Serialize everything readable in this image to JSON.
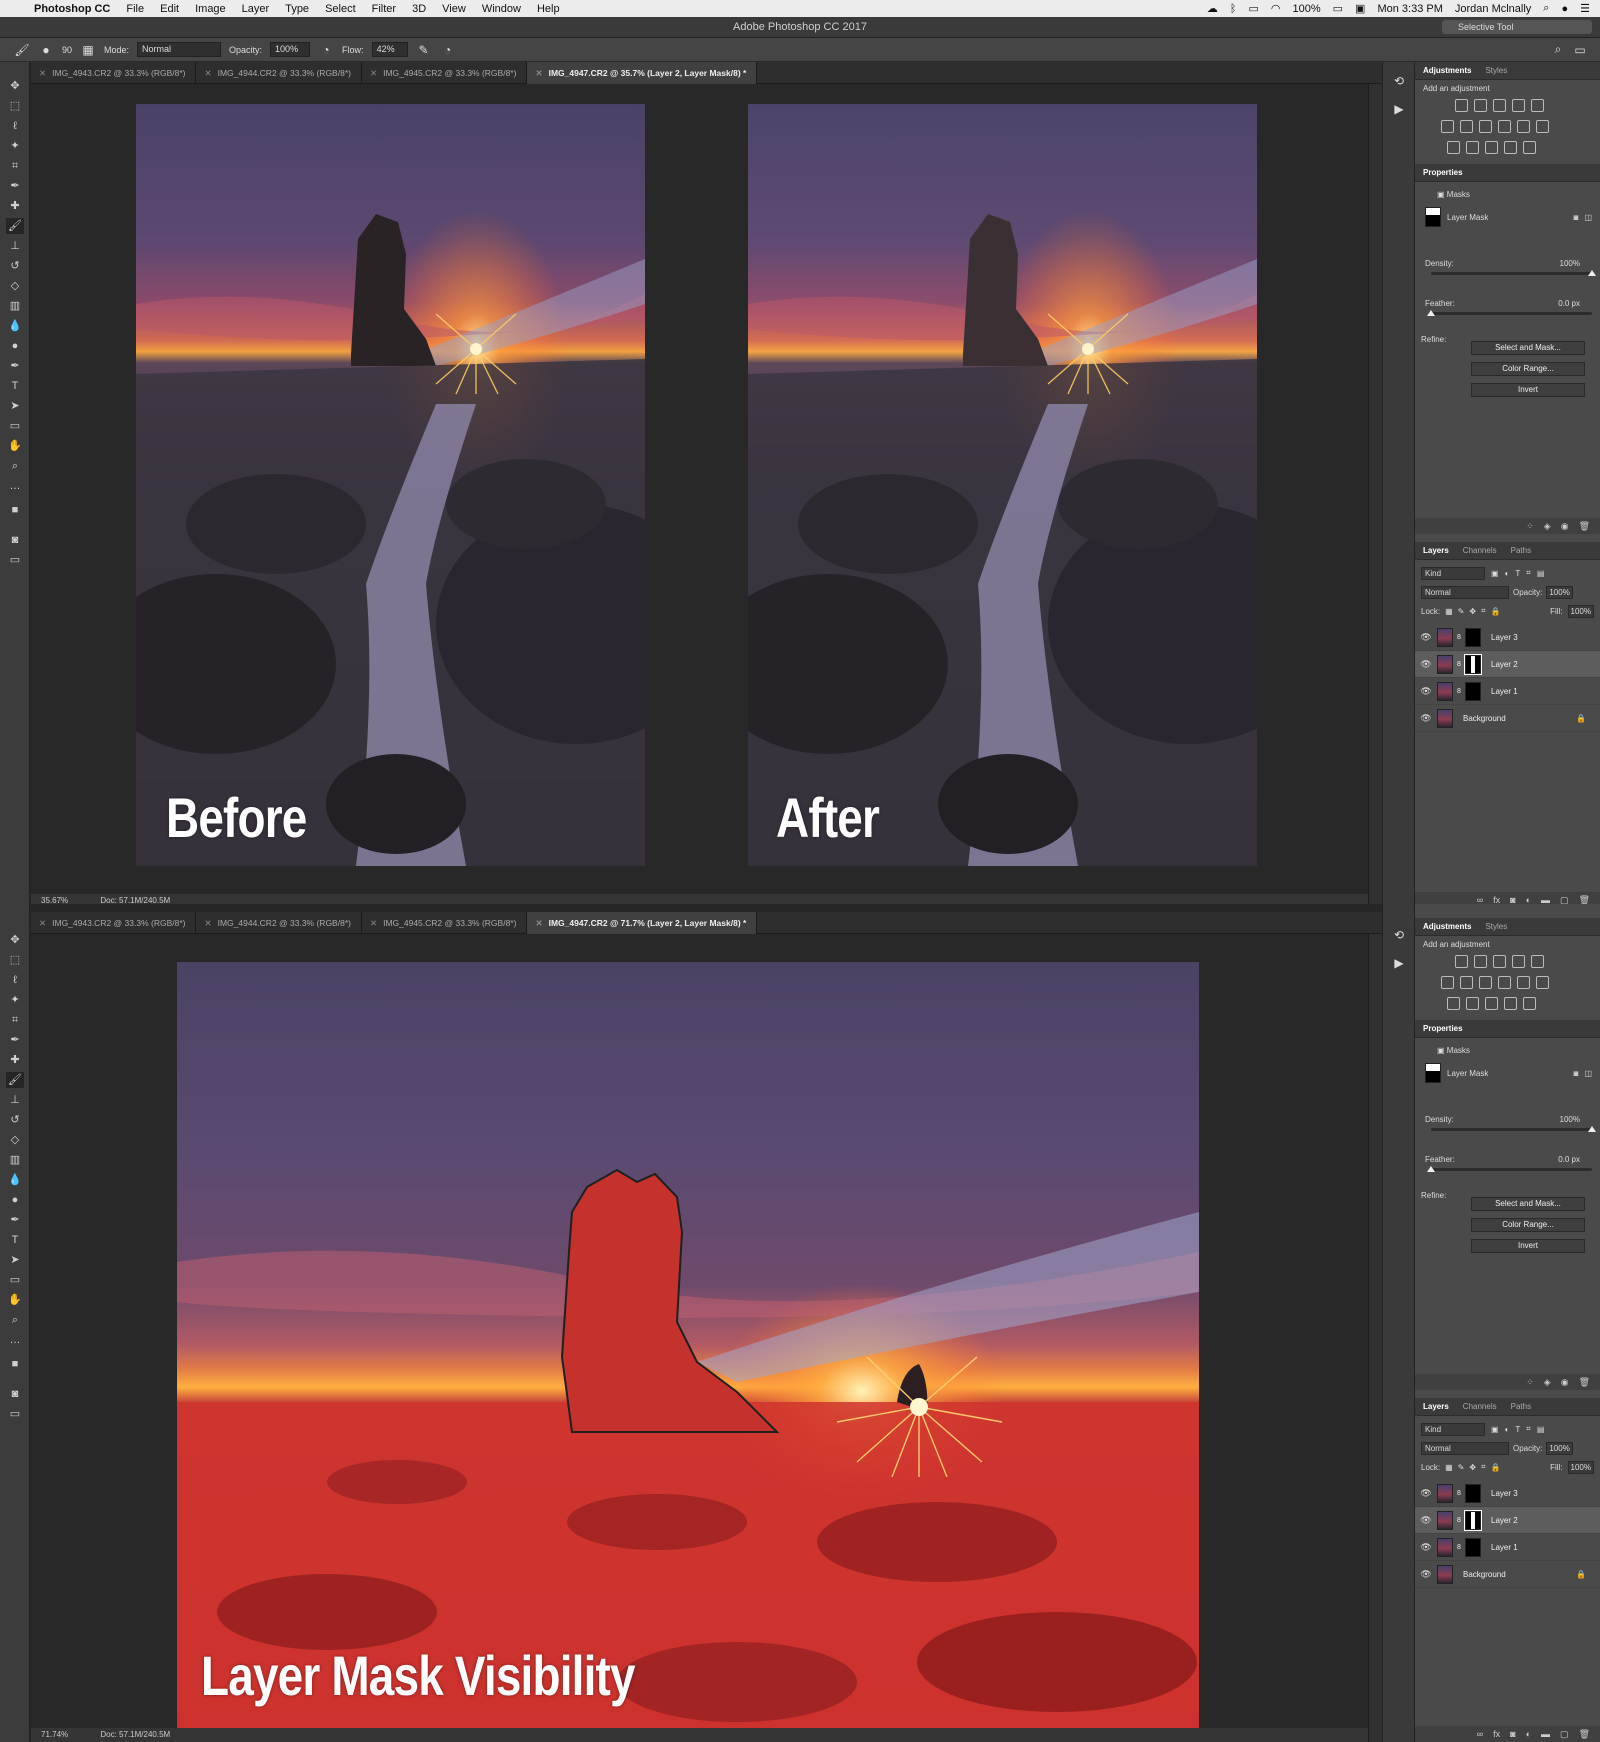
{
  "menubar": {
    "app": "Photoshop CC",
    "items": [
      "File",
      "Edit",
      "Image",
      "Layer",
      "Type",
      "Select",
      "Filter",
      "3D",
      "View",
      "Window",
      "Help"
    ],
    "battery": "100%",
    "clock": "Mon 3:33 PM",
    "user": "Jordan Mclnally"
  },
  "window": {
    "title": "Adobe Photoshop CC 2017",
    "workspace": "Selective Tool"
  },
  "options": {
    "brush_size": "90",
    "mode_label": "Mode:",
    "mode_value": "Normal",
    "opacity_label": "Opacity:",
    "opacity_value": "100%",
    "flow_label": "Flow:",
    "flow_value": "42%"
  },
  "top_pane": {
    "tabs": [
      "IMG_4943.CR2 @ 33.3% (RGB/8*)",
      "IMG_4944.CR2 @ 33.3% (RGB/8*)",
      "IMG_4945.CR2 @ 33.3% (RGB/8*)",
      "IMG_4947.CR2 @ 35.7% (Layer 2, Layer Mask/8) *"
    ],
    "zoom": "35.67%",
    "doc": "Doc: 57.1M/240.5M",
    "before_label": "Before",
    "after_label": "After"
  },
  "bottom_pane": {
    "tabs": [
      "IMG_4943.CR2 @ 33.3% (RGB/8*)",
      "IMG_4944.CR2 @ 33.3% (RGB/8*)",
      "IMG_4945.CR2 @ 33.3% (RGB/8*)",
      "IMG_4947.CR2 @ 71.7% (Layer 2, Layer Mask/8) *"
    ],
    "zoom": "71.74%",
    "doc": "Doc: 57.1M/240.5M",
    "caption": "Layer Mask Visibility"
  },
  "panel": {
    "adjustments_tab": "Adjustments",
    "styles_tab": "Styles",
    "add_adjustment": "Add an adjustment",
    "properties_title": "Properties",
    "masks_label": "Masks",
    "layer_mask_label": "Layer Mask",
    "density_label": "Density:",
    "density_value": "100%",
    "feather_label": "Feather:",
    "feather_value": "0.0 px",
    "refine_label": "Refine:",
    "select_and_mask": "Select and Mask...",
    "color_range": "Color Range...",
    "invert": "Invert",
    "layers_tab": "Layers",
    "channels_tab": "Channels",
    "paths_tab": "Paths",
    "kind_filter": "Kind",
    "blend_mode": "Normal",
    "opacity_label": "Opacity:",
    "opacity_value": "100%",
    "lock_label": "Lock:",
    "fill_label": "Fill:",
    "fill_value": "100%",
    "layers": [
      "Layer 3",
      "Layer 2",
      "Layer 1",
      "Background"
    ],
    "selected_layer": "Layer 2"
  }
}
